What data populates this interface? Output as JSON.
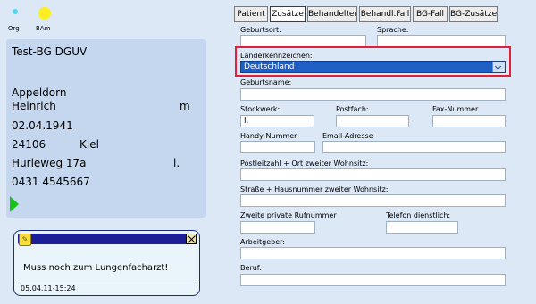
{
  "indicators": [
    {
      "label": "Org",
      "color": "#4fd7ee"
    },
    {
      "label": "BAm",
      "color": "#ffef20"
    }
  ],
  "patient": {
    "insurer": "Test-BG DGUV",
    "last_name": "Appeldorn",
    "first_name": "Heinrich",
    "sex": "m",
    "birth_date": "02.04.1941",
    "postal_code": "24106",
    "city": "Kiel",
    "street": "Hurleweg 17a",
    "street_suffix": "l.",
    "phone": "0431 4545667"
  },
  "note": {
    "text": "Muss noch zum Lungenfacharzt!",
    "timestamp": "05.04.11-15:24"
  },
  "tabs": [
    {
      "label": "Patient"
    },
    {
      "label": "Zusätze"
    },
    {
      "label": "Behandelter"
    },
    {
      "label": "Behandl.Fall"
    },
    {
      "label": "BG-Fall"
    },
    {
      "label": "BG-Zusätze"
    }
  ],
  "form": {
    "geburtsort": {
      "label": "Geburtsort:",
      "value": ""
    },
    "sprache": {
      "label": "Sprache:",
      "value": ""
    },
    "laenderkennzeichen": {
      "label": "Länderkennzeichen:",
      "value": "Deutschland"
    },
    "geburtsname": {
      "label": "Geburtsname:",
      "value": ""
    },
    "stockwerk": {
      "label": "Stockwerk:",
      "value": "l."
    },
    "postfach": {
      "label": "Postfach:",
      "value": ""
    },
    "fax": {
      "label": "Fax-Nummer",
      "value": ""
    },
    "handy": {
      "label": "Handy-Nummer",
      "value": ""
    },
    "email": {
      "label": "Email-Adresse",
      "value": ""
    },
    "plz_ort2": {
      "label": "Postleitzahl + Ort zweiter Wohnsitz:",
      "value": ""
    },
    "strasse2": {
      "label": "Straße + Hausnummer zweiter Wohnsitz:",
      "value": ""
    },
    "privat_tel2": {
      "label": "Zweite private Rufnummer",
      "value": ""
    },
    "tel_dienst": {
      "label": "Telefon dienstlich:",
      "value": ""
    },
    "arbeitgeber": {
      "label": "Arbeitgeber:",
      "value": ""
    },
    "beruf": {
      "label": "Beruf:",
      "value": ""
    }
  }
}
